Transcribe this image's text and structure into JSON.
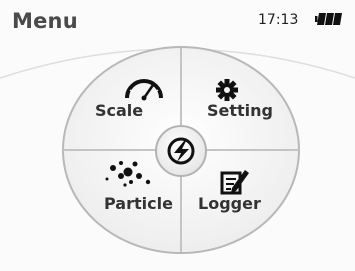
{
  "header": {
    "title": "Menu",
    "time": "17:13",
    "battery_icon": "battery-icon"
  },
  "menu": {
    "center_icon": "power-bolt-icon",
    "items": [
      {
        "id": "scale",
        "label": "Scale",
        "icon": "gauge-icon"
      },
      {
        "id": "setting",
        "label": "Setting",
        "icon": "gear-icon"
      },
      {
        "id": "particle",
        "label": "Particle",
        "icon": "particles-icon"
      },
      {
        "id": "logger",
        "label": "Logger",
        "icon": "notepad-pencil-icon"
      }
    ]
  },
  "colors": {
    "dial_fill": "#f4f4f4",
    "dial_border": "#b8b8b8",
    "icon_dark": "#111111",
    "text": "#333333",
    "title": "#4a4a4a"
  }
}
